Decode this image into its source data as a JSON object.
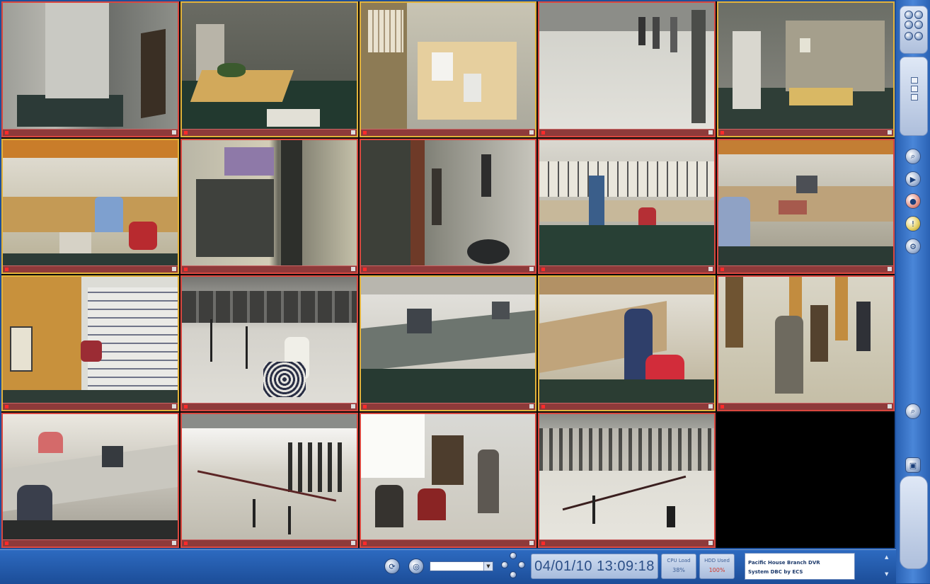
{
  "toolbar": {
    "datetime": "04/01/10 13:09:18",
    "dropdown_value": "",
    "meter1": {
      "label": "CPU Load",
      "value": "38%"
    },
    "meter2": {
      "label": "HDD Used",
      "value": "100%"
    },
    "info_line1": "Pacific House Branch DVR",
    "info_line2": "System DBC by ECS"
  },
  "icons": {
    "cycle": "cycle-icon",
    "globe": "globe-icon"
  },
  "colors": {
    "frame_red": "#d9473f",
    "frame_selected": "#e2b23a",
    "ui_blue": "#1d4f9a"
  }
}
